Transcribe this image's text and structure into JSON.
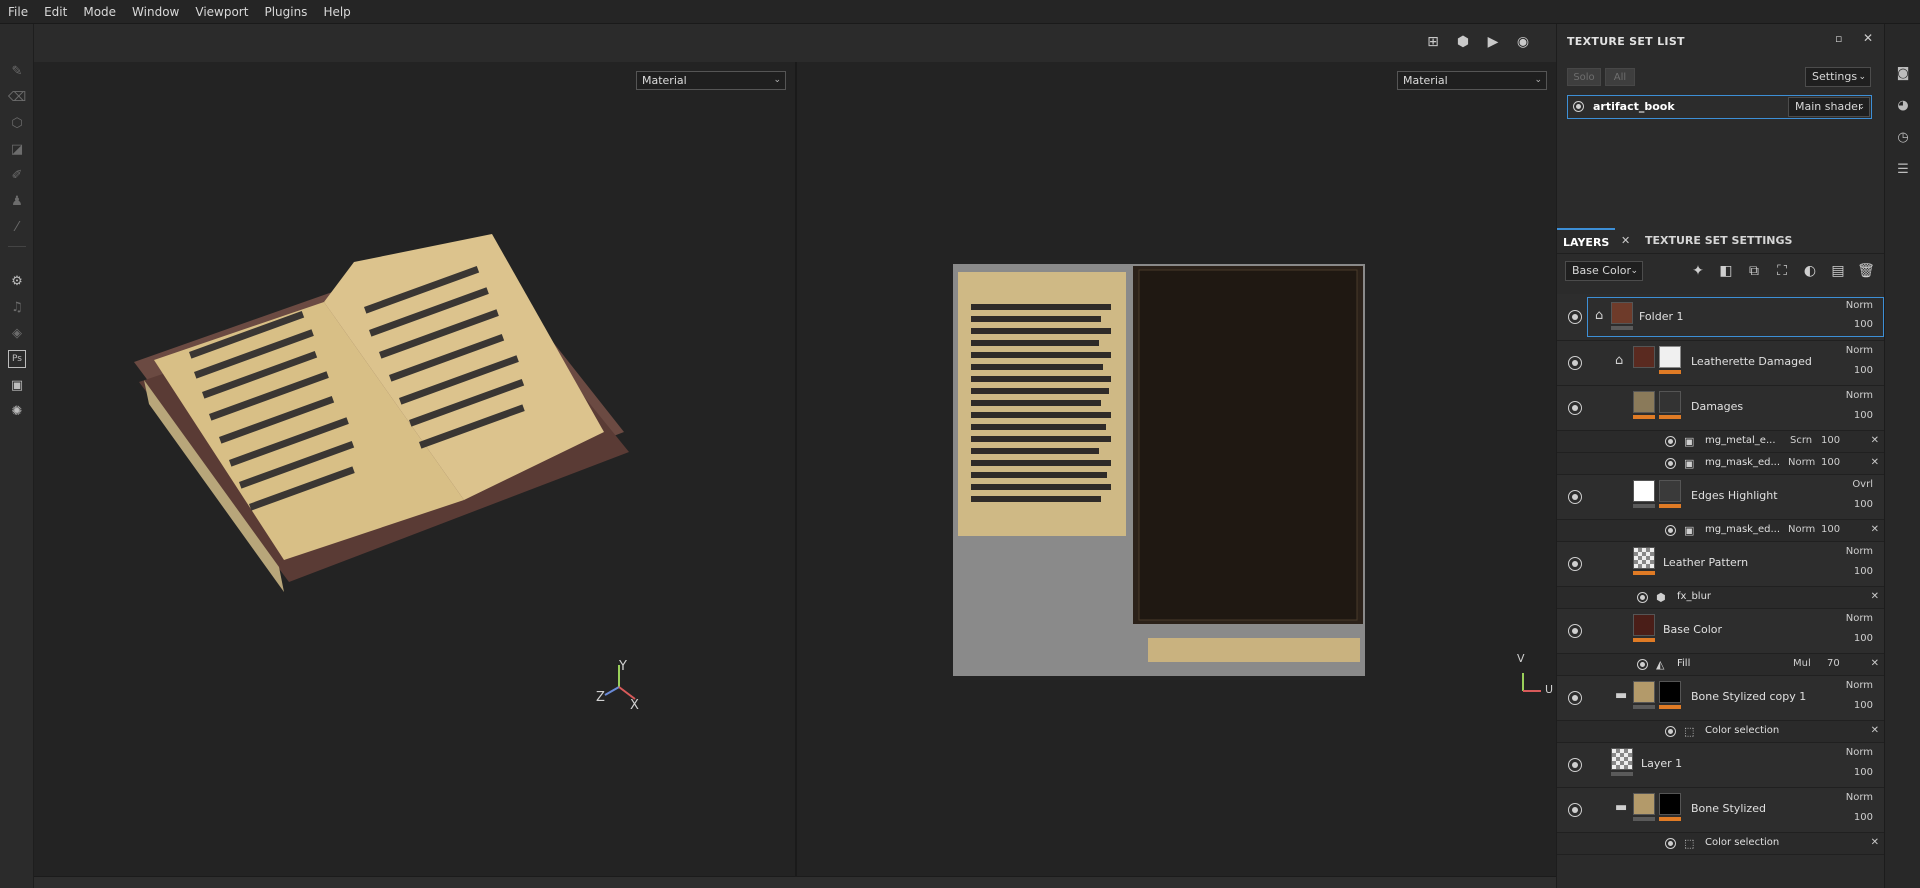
{
  "menu": [
    "File",
    "Edit",
    "Mode",
    "Window",
    "Viewport",
    "Plugins",
    "Help"
  ],
  "viewport_left": {
    "mode": "Material",
    "axes": {
      "y": "Y",
      "z": "Z",
      "x": "X"
    }
  },
  "viewport_right": {
    "mode": "Material",
    "axes": {
      "v": "V",
      "u": "U"
    }
  },
  "texture_set_list": {
    "title": "TEXTURE SET LIST",
    "solo_label": "Solo",
    "all_label": "All",
    "settings_label": "Settings",
    "set_name": "artifact_book",
    "shader": "Main shader"
  },
  "tabs": {
    "layers": "LAYERS",
    "texture_set_settings": "TEXTURE SET SETTINGS"
  },
  "channel": "Base Color",
  "layers": [
    {
      "name": "Folder 1",
      "blend": "Norm",
      "opacity": "100"
    },
    {
      "name": "Leatherette Damaged",
      "blend": "Norm",
      "opacity": "100"
    },
    {
      "name": "Damages",
      "blend": "Norm",
      "opacity": "100"
    },
    {
      "name": "mg_metal_e...",
      "blend": "Scrn",
      "opacity": "100"
    },
    {
      "name": "mg_mask_ed...",
      "blend": "Norm",
      "opacity": "100"
    },
    {
      "name": "Edges Highlight",
      "blend": "Ovrl",
      "opacity": "100"
    },
    {
      "name": "mg_mask_ed...",
      "blend": "Norm",
      "opacity": "100"
    },
    {
      "name": "Leather Pattern",
      "blend": "Norm",
      "opacity": "100"
    },
    {
      "name": "fx_blur"
    },
    {
      "name": "Base Color",
      "blend": "Norm",
      "opacity": "100"
    },
    {
      "name": "Fill",
      "blend": "Mul",
      "opacity": "70"
    },
    {
      "name": "Bone Stylized copy 1",
      "blend": "Norm",
      "opacity": "100"
    },
    {
      "name": "Color selection"
    },
    {
      "name": "Layer 1",
      "blend": "Norm",
      "opacity": "100"
    },
    {
      "name": "Bone Stylized",
      "blend": "Norm",
      "opacity": "100"
    },
    {
      "name": "Color selection"
    }
  ],
  "colors": {
    "accent": "#3d8fd6",
    "mask_orange": "#e07b25",
    "bg": "#2b2b2b",
    "viewport_bg": "#232323"
  }
}
